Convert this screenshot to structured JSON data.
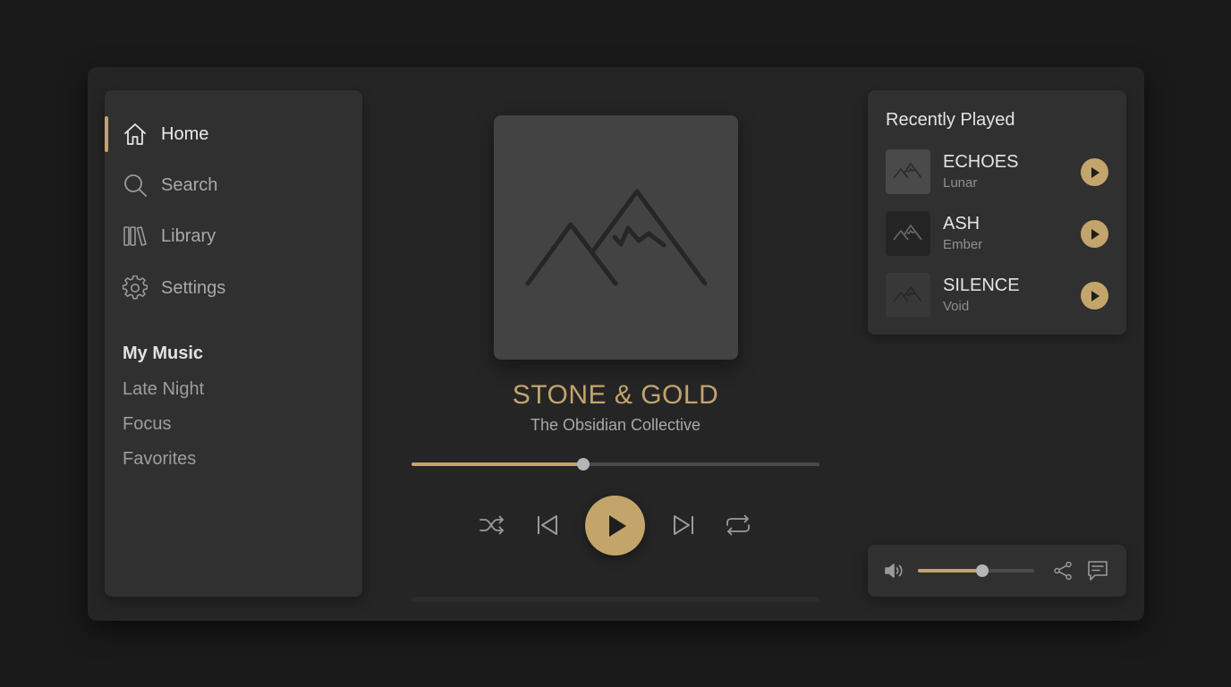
{
  "sidebar": {
    "nav": [
      {
        "label": "Home",
        "icon": "home-icon",
        "active": true
      },
      {
        "label": "Search",
        "icon": "search-icon",
        "active": false
      },
      {
        "label": "Library",
        "icon": "library-icon",
        "active": false
      },
      {
        "label": "Settings",
        "icon": "gear-icon",
        "active": false
      }
    ],
    "section_title": "My Music",
    "playlists": [
      "Late Night",
      "Focus",
      "Favorites"
    ]
  },
  "player": {
    "title": "STONE & GOLD",
    "artist": "The Obsidian Collective",
    "progress_fraction": 0.42,
    "album_art_icon": "mountain-icon"
  },
  "recently_played": {
    "title": "Recently Played",
    "items": [
      {
        "name": "ECHOES",
        "artist": "Lunar"
      },
      {
        "name": "ASH",
        "artist": "Ember"
      },
      {
        "name": "SILENCE",
        "artist": "Void"
      }
    ]
  },
  "volume": {
    "level_fraction": 0.55
  },
  "colors": {
    "accent": "#c3a46a",
    "background": "#1a1a1a",
    "panel": "#303030",
    "window": "#252525"
  }
}
